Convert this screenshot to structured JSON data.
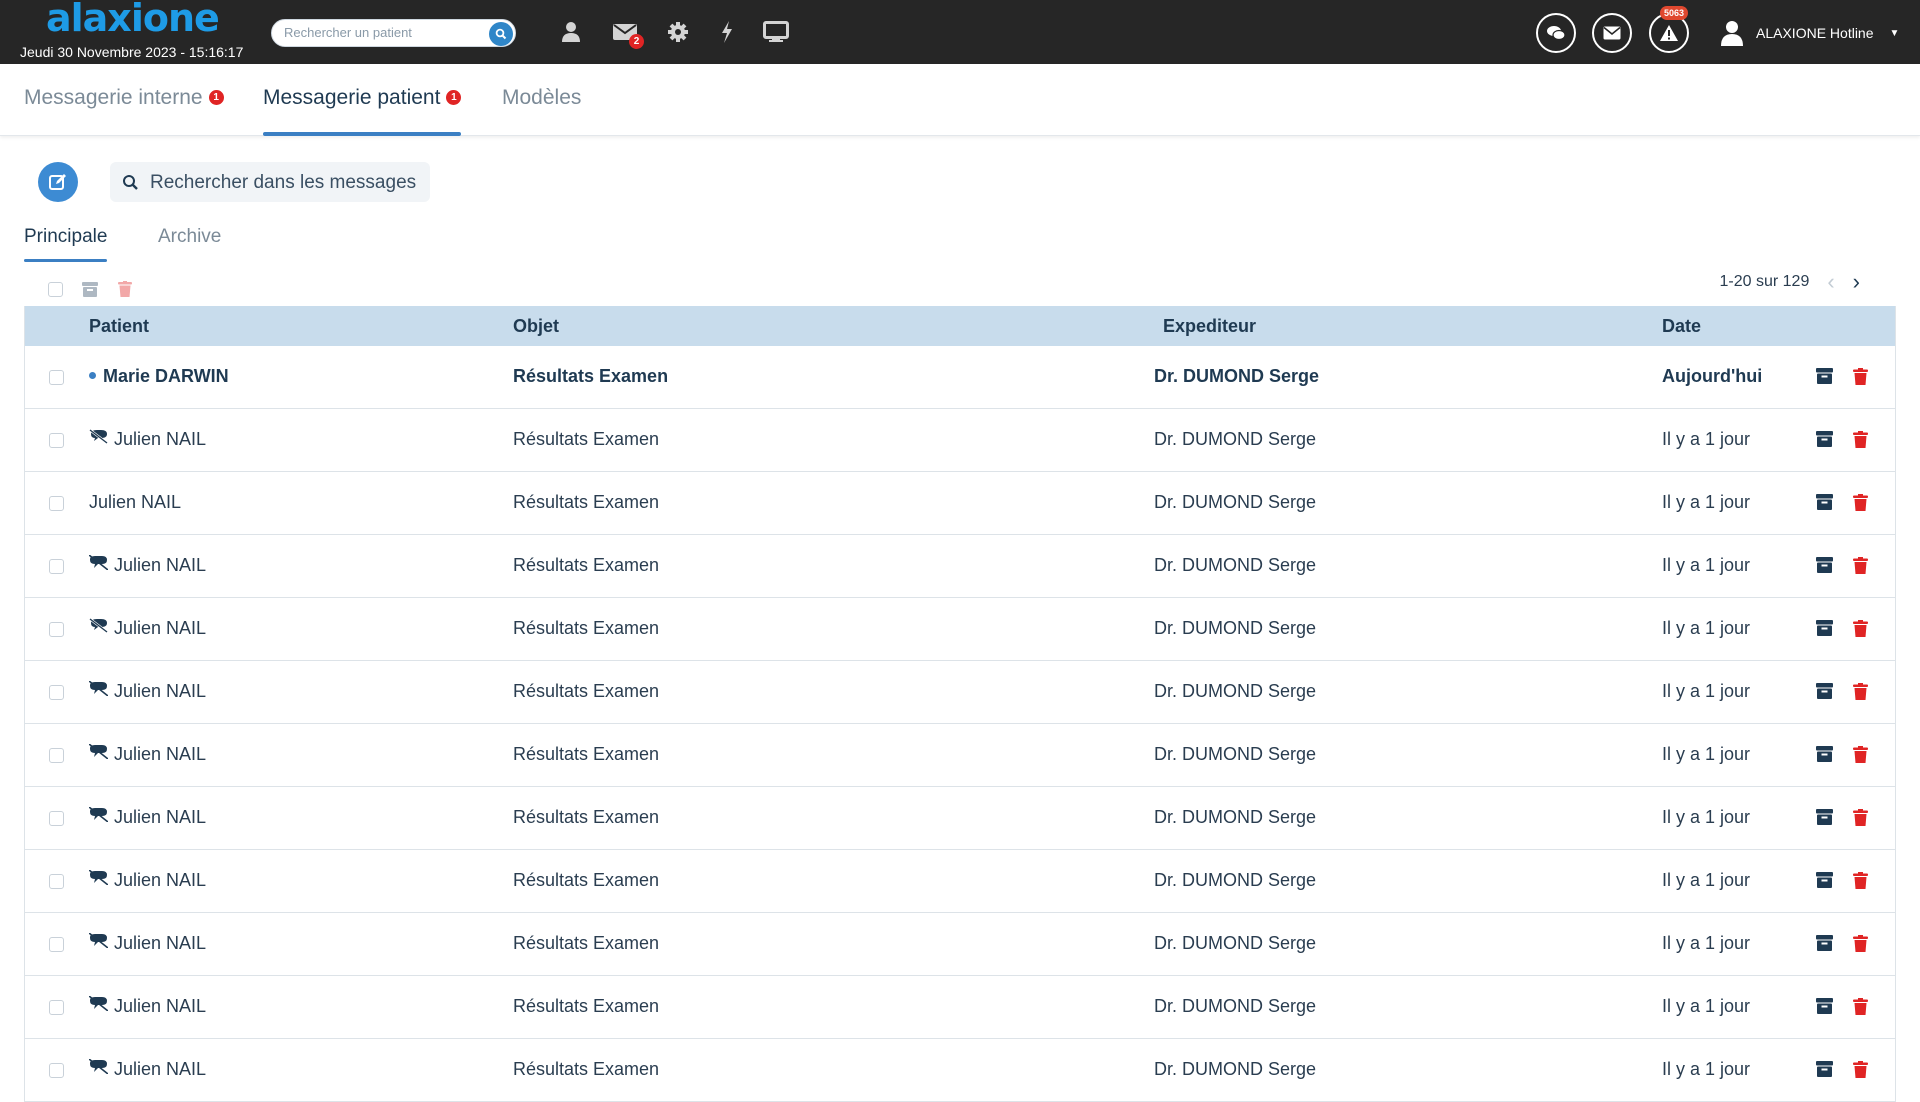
{
  "app": {
    "logo_text": "alaxione",
    "datetime": "Jeudi 30 Novembre 2023 - 15:16:17"
  },
  "topbar": {
    "patient_search_placeholder": "Rechercher un patient",
    "mail_badge": "2",
    "alert_badge": "5063",
    "user_name": "ALAXIONE Hotline",
    "icons": [
      "user-icon",
      "mail-icon",
      "gear-icon",
      "bolt-icon",
      "monitor-icon",
      "chat-icon",
      "envelope-icon",
      "alert-icon"
    ]
  },
  "main_tabs": [
    {
      "label": "Messagerie interne",
      "badge": "1",
      "active": false
    },
    {
      "label": "Messagerie patient",
      "badge": "1",
      "active": true
    },
    {
      "label": "Modèles",
      "badge": "",
      "active": false
    }
  ],
  "toolbar": {
    "search_placeholder": "Rechercher dans les messages"
  },
  "subtabs": [
    {
      "label": "Principale",
      "active": true
    },
    {
      "label": "Archive",
      "active": false
    }
  ],
  "pager": {
    "text": "1-20 sur 129"
  },
  "table": {
    "headers": {
      "patient": "Patient",
      "objet": "Objet",
      "expediteur": "Expediteur",
      "date": "Date"
    },
    "rows": [
      {
        "patient": "Marie DARWIN",
        "objet": "Résultats Examen",
        "expediteur": "Dr. DUMOND Serge",
        "date": "Aujourd'hui",
        "unread": true,
        "status_icon": "unread-dot"
      },
      {
        "patient": "Julien NAIL",
        "objet": "Résultats Examen",
        "expediteur": "Dr. DUMOND Serge",
        "date": "Il y a 1 jour",
        "unread": false,
        "status_icon": "hidden-icon"
      },
      {
        "patient": "Julien NAIL",
        "objet": "Résultats Examen",
        "expediteur": "Dr. DUMOND Serge",
        "date": "Il y a 1 jour",
        "unread": false,
        "status_icon": ""
      },
      {
        "patient": "Julien NAIL",
        "objet": "Résultats Examen",
        "expediteur": "Dr. DUMOND Serge",
        "date": "Il y a 1 jour",
        "unread": false,
        "status_icon": "chat-off-icon"
      },
      {
        "patient": "Julien NAIL",
        "objet": "Résultats Examen",
        "expediteur": "Dr. DUMOND Serge",
        "date": "Il y a 1 jour",
        "unread": false,
        "status_icon": "hidden-icon"
      },
      {
        "patient": "Julien NAIL",
        "objet": "Résultats Examen",
        "expediteur": "Dr. DUMOND Serge",
        "date": "Il y a 1 jour",
        "unread": false,
        "status_icon": "chat-off-icon"
      },
      {
        "patient": "Julien NAIL",
        "objet": "Résultats Examen",
        "expediteur": "Dr. DUMOND Serge",
        "date": "Il y a 1 jour",
        "unread": false,
        "status_icon": "chat-off-icon"
      },
      {
        "patient": "Julien NAIL",
        "objet": "Résultats Examen",
        "expediteur": "Dr. DUMOND Serge",
        "date": "Il y a 1 jour",
        "unread": false,
        "status_icon": "chat-off-icon"
      },
      {
        "patient": "Julien NAIL",
        "objet": "Résultats Examen",
        "expediteur": "Dr. DUMOND Serge",
        "date": "Il y a 1 jour",
        "unread": false,
        "status_icon": "chat-off-icon"
      },
      {
        "patient": "Julien NAIL",
        "objet": "Résultats Examen",
        "expediteur": "Dr. DUMOND Serge",
        "date": "Il y a 1 jour",
        "unread": false,
        "status_icon": "chat-off-icon"
      },
      {
        "patient": "Julien NAIL",
        "objet": "Résultats Examen",
        "expediteur": "Dr. DUMOND Serge",
        "date": "Il y a 1 jour",
        "unread": false,
        "status_icon": "chat-off-icon"
      },
      {
        "patient": "Julien NAIL",
        "objet": "Résultats Examen",
        "expediteur": "Dr. DUMOND Serge",
        "date": "Il y a 1 jour",
        "unread": false,
        "status_icon": "chat-off-icon"
      }
    ]
  },
  "colors": {
    "topbar": "#262626",
    "accent": "#3b7fc3",
    "header_row": "#c8dcec",
    "danger": "#e02424",
    "archive_icon": "#1f3a52"
  }
}
